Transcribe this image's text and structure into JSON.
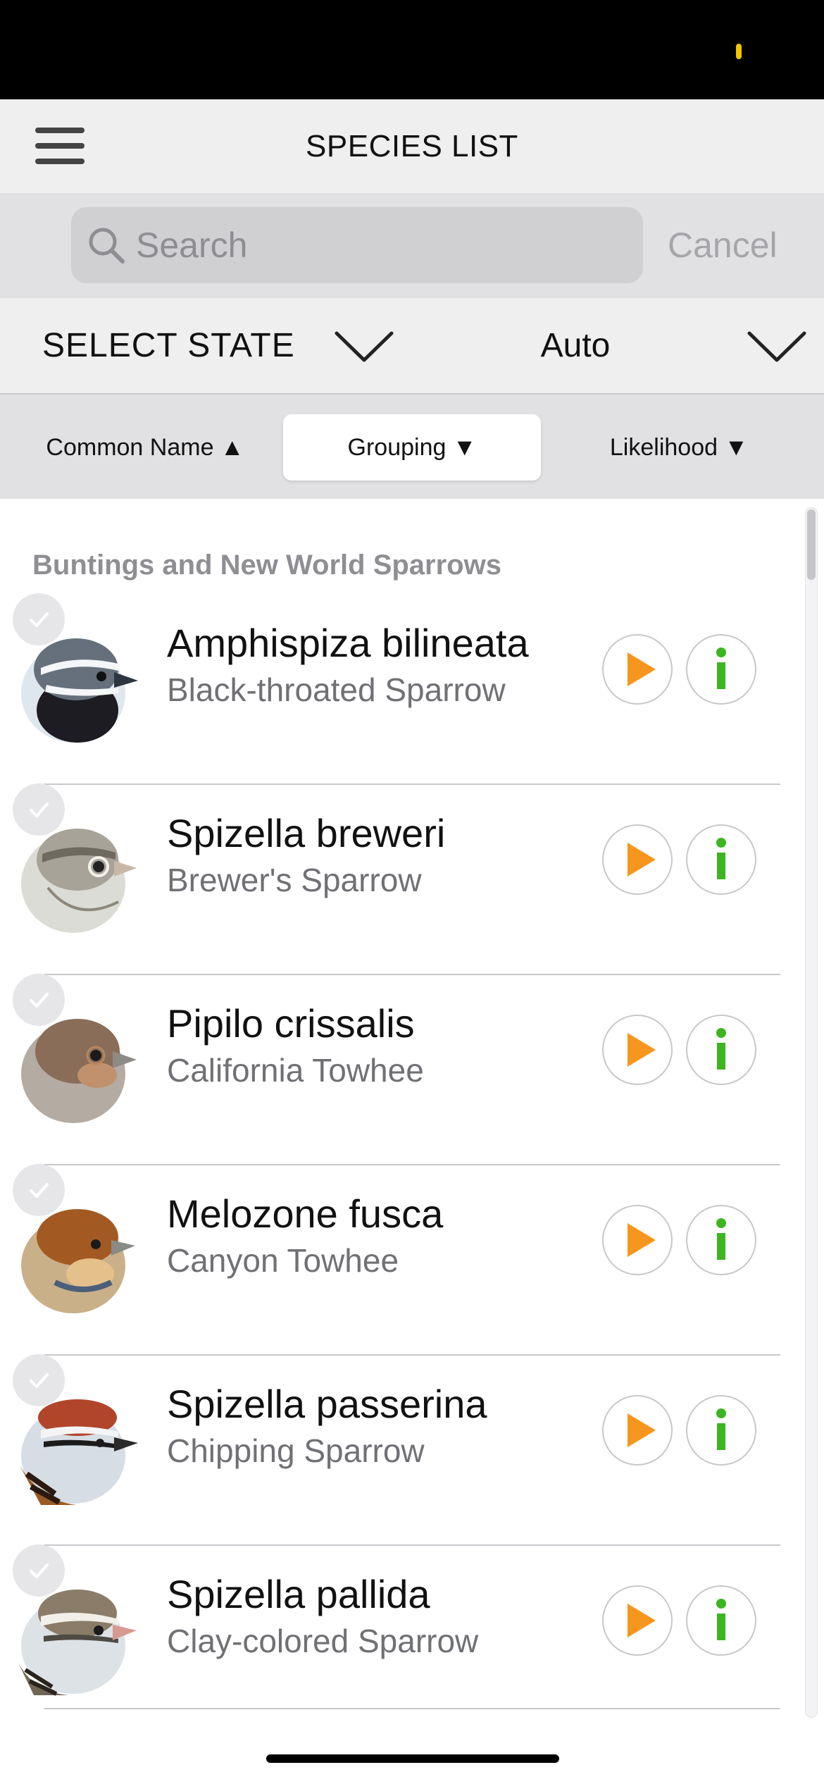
{
  "nav": {
    "title": "SPECIES LIST"
  },
  "search": {
    "placeholder": "Search",
    "value": "",
    "cancel_label": "Cancel"
  },
  "filters": {
    "state_label": "SELECT STATE",
    "state_value": "Auto"
  },
  "sort": {
    "options": [
      {
        "label": "Common Name ▲",
        "active": false
      },
      {
        "label": "Grouping ▼",
        "active": true
      },
      {
        "label": "Likelihood ▼",
        "active": false
      }
    ]
  },
  "section": {
    "title": "Buntings and New World Sparrows"
  },
  "species": [
    {
      "scientific": "Amphispiza bilineata",
      "common": "Black-throated Sparrow"
    },
    {
      "scientific": "Spizella breweri",
      "common": "Brewer's Sparrow"
    },
    {
      "scientific": "Pipilo crissalis",
      "common": "California Towhee"
    },
    {
      "scientific": "Melozone fusca",
      "common": "Canyon Towhee"
    },
    {
      "scientific": "Spizella passerina",
      "common": "Chipping Sparrow"
    },
    {
      "scientific": "Spizella pallida",
      "common": "Clay-colored Sparrow"
    }
  ],
  "icons": {
    "menu": "hamburger-icon",
    "search": "magnifier-icon",
    "dropdown": "chevron-down-icon",
    "play": "play-triangle-icon",
    "info": "info-i-icon",
    "check": "checkmark-icon"
  },
  "colors": {
    "play_accent": "#f7961e",
    "info_accent": "#3cb521",
    "status_indicator": "#f5c400"
  }
}
